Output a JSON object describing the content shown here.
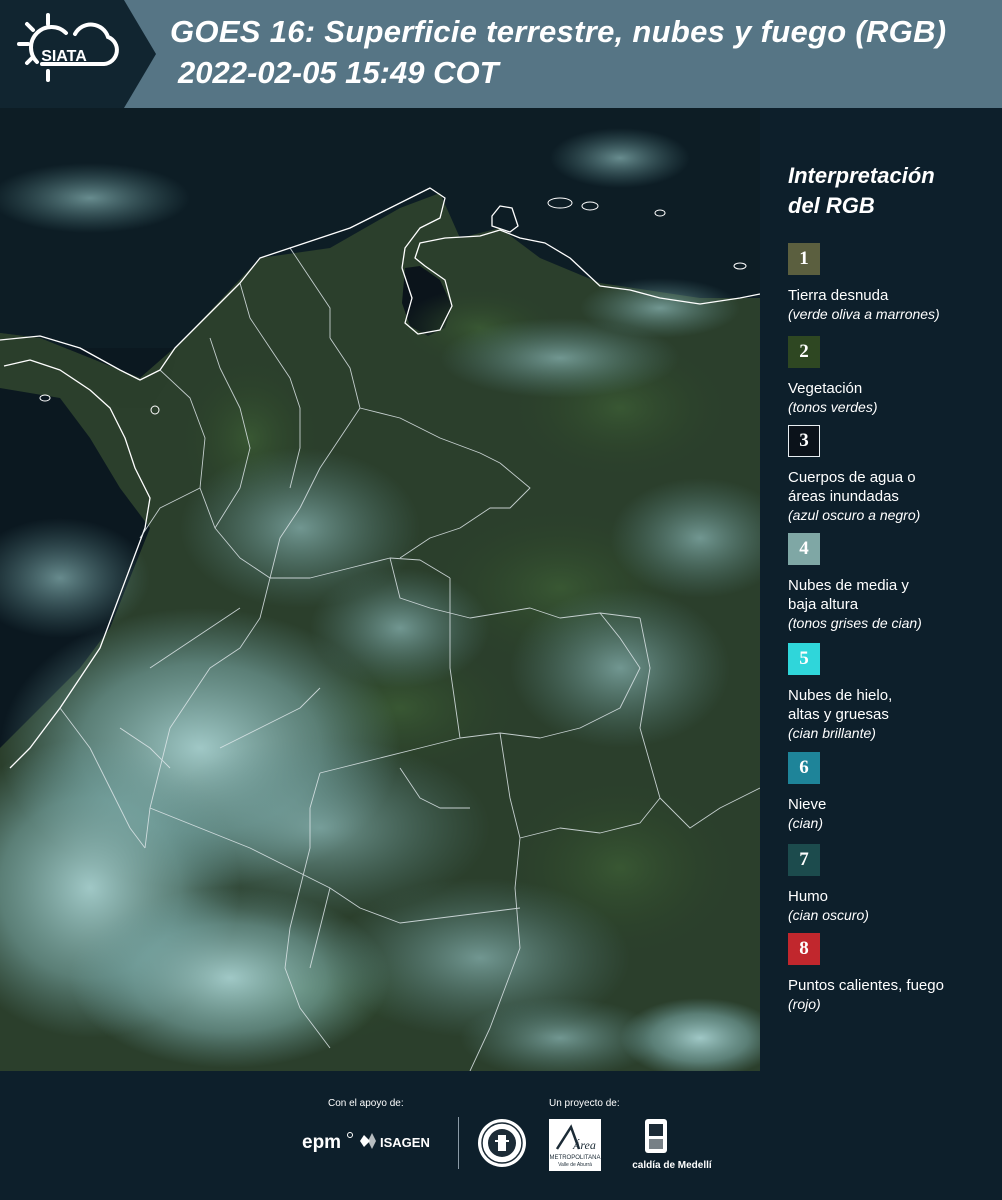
{
  "header": {
    "logo_text": "SIATA",
    "title_line1": "GOES 16: Superficie terrestre, nubes y fuego (RGB)",
    "title_line2": "2022-02-05 15:49 COT"
  },
  "legend": {
    "title_line1": "Interpretación",
    "title_line2": "del RGB",
    "items": [
      {
        "number": "1",
        "label_lines": [
          "Tierra desnuda"
        ],
        "desc": "(verde oliva a marrones)",
        "color": "#5b5f3f",
        "border": "#5b5f3f"
      },
      {
        "number": "2",
        "label_lines": [
          "Vegetación"
        ],
        "desc": "(tonos verdes)",
        "color": "#2e4722",
        "border": "#2e4722"
      },
      {
        "number": "3",
        "label_lines": [
          "Cuerpos de agua o",
          "áreas inundadas"
        ],
        "desc": "(azul oscuro a negro)",
        "color": "#0b121a",
        "border": "#e8eef2"
      },
      {
        "number": "4",
        "label_lines": [
          "Nubes de media y",
          "baja altura"
        ],
        "desc": "(tonos grises de cian)",
        "color": "#7fa7a5",
        "border": "#7fa7a5"
      },
      {
        "number": "5",
        "label_lines": [
          "Nubes de hielo,",
          "altas y gruesas"
        ],
        "desc": "(cian brillante)",
        "color": "#2fd6da",
        "border": "#2fd6da"
      },
      {
        "number": "6",
        "label_lines": [
          "Nieve"
        ],
        "desc": "(cian)",
        "color": "#1e8499",
        "border": "#1e8499"
      },
      {
        "number": "7",
        "label_lines": [
          "Humo"
        ],
        "desc": "(cian oscuro)",
        "color": "#1c4b4d",
        "border": "#1c4b4d"
      },
      {
        "number": "8",
        "label_lines": [
          "Puntos calientes, fuego"
        ],
        "desc": "(rojo)",
        "color": "#c1272d",
        "border": "#c1272d"
      }
    ]
  },
  "footer": {
    "support_label": "Con el apoyo de:",
    "project_label": "Un proyecto de:",
    "epm_logo": "epm",
    "isagen_logo": "ISAGEN",
    "area_logo_line1": "Área",
    "area_logo_line2": "METROPOLITANA",
    "area_logo_line3": "Valle de Aburrá",
    "alcaldia_logo": "Alcaldía de Medellín"
  }
}
